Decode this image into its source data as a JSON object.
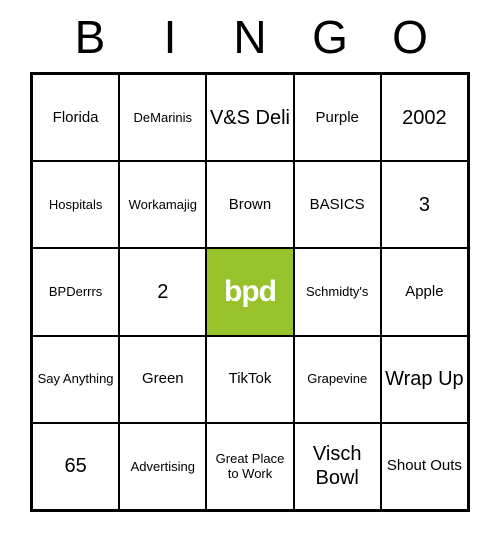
{
  "header": [
    "B",
    "I",
    "N",
    "G",
    "O"
  ],
  "free_label": "bpd",
  "free_color": "#97c22a",
  "cells": [
    [
      {
        "text": "Florida",
        "size": "normal"
      },
      {
        "text": "DeMarinis",
        "size": "small"
      },
      {
        "text": "V&S Deli",
        "size": "large"
      },
      {
        "text": "Purple",
        "size": "normal"
      },
      {
        "text": "2002",
        "size": "large"
      }
    ],
    [
      {
        "text": "Hospitals",
        "size": "small"
      },
      {
        "text": "Workamajig",
        "size": "small"
      },
      {
        "text": "Brown",
        "size": "normal"
      },
      {
        "text": "BASICS",
        "size": "normal"
      },
      {
        "text": "3",
        "size": "large"
      }
    ],
    [
      {
        "text": "BPDerrrs",
        "size": "small"
      },
      {
        "text": "2",
        "size": "large"
      },
      {
        "text": "",
        "size": "normal",
        "free": true
      },
      {
        "text": "Schmidty's",
        "size": "small"
      },
      {
        "text": "Apple",
        "size": "normal"
      }
    ],
    [
      {
        "text": "Say Anything",
        "size": "small"
      },
      {
        "text": "Green",
        "size": "normal"
      },
      {
        "text": "TikTok",
        "size": "normal"
      },
      {
        "text": "Grapevine",
        "size": "small"
      },
      {
        "text": "Wrap Up",
        "size": "large"
      }
    ],
    [
      {
        "text": "65",
        "size": "large"
      },
      {
        "text": "Advertising",
        "size": "small"
      },
      {
        "text": "Great Place to Work",
        "size": "small"
      },
      {
        "text": "Visch Bowl",
        "size": "large"
      },
      {
        "text": "Shout Outs",
        "size": "normal"
      }
    ]
  ]
}
